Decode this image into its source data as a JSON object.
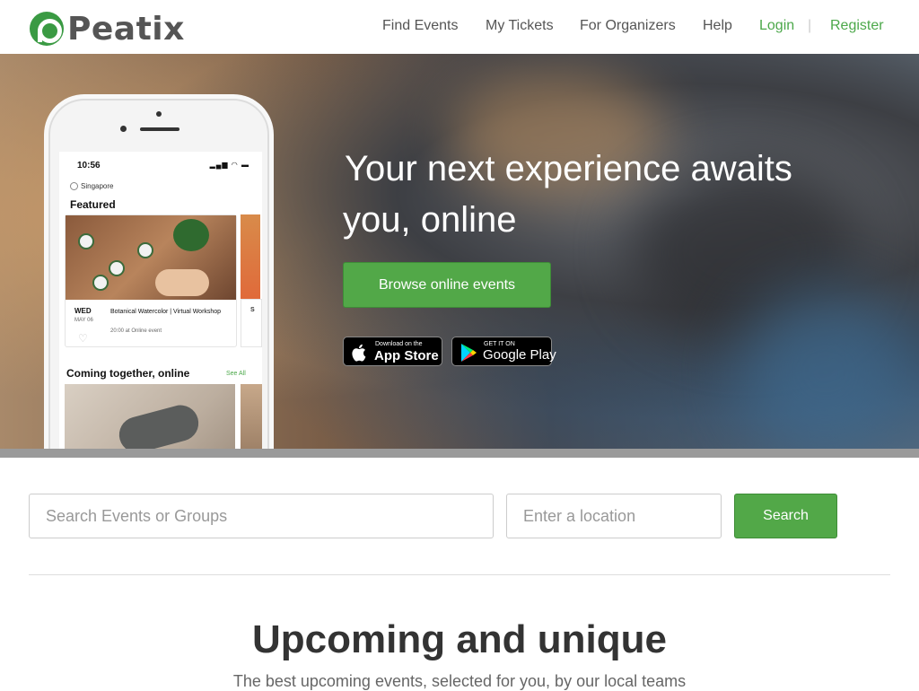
{
  "header": {
    "logo_text": "Peatix",
    "nav": [
      {
        "label": "Find Events"
      },
      {
        "label": "My Tickets"
      },
      {
        "label": "For Organizers"
      },
      {
        "label": "Help"
      },
      {
        "label": "Login"
      },
      {
        "label": "Register"
      }
    ],
    "separator": "|"
  },
  "hero": {
    "headline_line1": "Your next experience awaits",
    "headline_line2": "you, online",
    "browse_button": "Browse online events",
    "app_store": {
      "small": "Download on the",
      "big": "App Store"
    },
    "google_play": {
      "small": "GET IT ON",
      "big": "Google Play"
    },
    "phone": {
      "time": "10:56",
      "location": "Singapore",
      "section_featured": "Featured",
      "event": {
        "day": "WED",
        "month": "MAY 06",
        "title": "Botanical Watercolor | Virtual Workshop",
        "where": "20:00 at Online event"
      },
      "card2_initial": "S",
      "section_online": "Coming together, online",
      "see_all": "See All"
    }
  },
  "search": {
    "query_placeholder": "Search Events or Groups",
    "location_placeholder": "Enter a location",
    "button": "Search"
  },
  "upcoming": {
    "title": "Upcoming and unique",
    "subtitle_part1": "The best upcoming events",
    "subtitle_part2": ", selected for you, by our local teams"
  },
  "colors": {
    "brand_green": "#52a848",
    "logo_green": "#3a9a43"
  }
}
